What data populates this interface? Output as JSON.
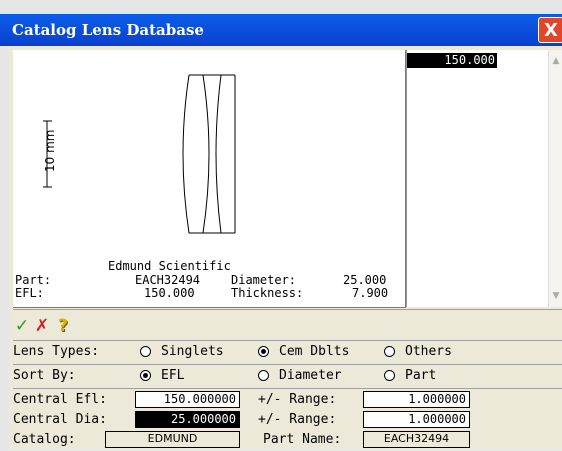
{
  "window": {
    "title": "Catalog Lens Database",
    "close_label": "X"
  },
  "preview": {
    "scale_label": "10 mm",
    "manufacturer": "Edmund Scientific",
    "part_label": "Part:",
    "part_value": "EACH32494",
    "diameter_label": "Diameter:",
    "diameter_value": "25.000",
    "efl_label": "EFL:",
    "efl_value": "150.000",
    "thickness_label": "Thickness:",
    "thickness_value": "7.900"
  },
  "list": {
    "selected_item": "150.000"
  },
  "toolbar": {
    "accept_icon": "check-icon",
    "accept_glyph": "✓",
    "cancel_icon": "x-icon",
    "cancel_glyph": "✗",
    "help_icon": "question-icon",
    "help_glyph": "?"
  },
  "lens_types": {
    "label": "Lens Types:",
    "options": [
      "Singlets",
      "Cem Dblts",
      "Others"
    ],
    "selected": "Cem Dblts"
  },
  "sort_by": {
    "label": "Sort By:",
    "options": [
      "EFL",
      "Diameter",
      "Part"
    ],
    "selected": "EFL"
  },
  "central_efl": {
    "label": "Central Efl:",
    "value": "150.000000",
    "range_label": "+/- Range:",
    "range_value": "1.000000"
  },
  "central_dia": {
    "label": "Central Dia:",
    "value": "25.000000",
    "range_label": "+/- Range:",
    "range_value": "1.000000"
  },
  "catalog": {
    "label": "Catalog:",
    "value": "EDMUND",
    "part_name_label": "Part Name:",
    "part_name_value": "EACH32494"
  }
}
